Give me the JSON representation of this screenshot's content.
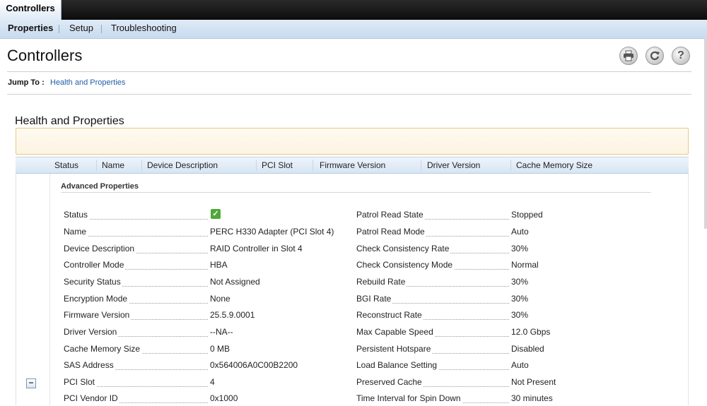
{
  "top_tab": "Controllers",
  "subnav": {
    "items": [
      "Properties",
      "Setup",
      "Troubleshooting"
    ]
  },
  "page_title": "Controllers",
  "toolbar": {
    "print_icon": "printer-icon",
    "refresh_icon": "refresh-icon",
    "help_icon": "help-icon",
    "help_glyph": "?"
  },
  "jump": {
    "label": "Jump To :",
    "link": "Health and Properties"
  },
  "section_title": "Health and Properties",
  "table": {
    "headers": [
      "Status",
      "Name",
      "Device Description",
      "PCI Slot",
      "Firmware Version",
      "Driver Version",
      "Cache Memory Size"
    ]
  },
  "collapse_glyph": "−",
  "advanced": {
    "title": "Advanced Properties",
    "left": [
      {
        "label": "Status",
        "value": "",
        "icon": "status-ok-icon"
      },
      {
        "label": "Name",
        "value": "PERC H330 Adapter (PCI Slot 4)"
      },
      {
        "label": "Device Description",
        "value": "RAID Controller in Slot 4"
      },
      {
        "label": "Controller Mode",
        "value": "HBA"
      },
      {
        "label": "Security Status",
        "value": "Not Assigned"
      },
      {
        "label": "Encryption Mode",
        "value": "None"
      },
      {
        "label": "Firmware Version",
        "value": "25.5.9.0001"
      },
      {
        "label": "Driver Version",
        "value": "--NA--"
      },
      {
        "label": "Cache Memory Size",
        "value": "0 MB"
      },
      {
        "label": "SAS Address",
        "value": "0x564006A0C00B2200"
      },
      {
        "label": "PCI Slot",
        "value": "4"
      },
      {
        "label": "PCI Vendor ID",
        "value": "0x1000"
      }
    ],
    "right": [
      {
        "label": "Patrol Read State",
        "value": "Stopped"
      },
      {
        "label": "Patrol Read Mode",
        "value": "Auto"
      },
      {
        "label": "Check Consistency Rate",
        "value": "30%"
      },
      {
        "label": "Check Consistency Mode",
        "value": "Normal"
      },
      {
        "label": "Rebuild Rate",
        "value": "30%"
      },
      {
        "label": "BGI Rate",
        "value": "30%"
      },
      {
        "label": "Reconstruct Rate",
        "value": "30%"
      },
      {
        "label": "Max Capable Speed",
        "value": "12.0 Gbps"
      },
      {
        "label": "Persistent Hotspare",
        "value": "Disabled"
      },
      {
        "label": "Load Balance Setting",
        "value": "Auto"
      },
      {
        "label": "Preserved Cache",
        "value": "Not Present"
      },
      {
        "label": "Time Interval for Spin Down",
        "value": "30 minutes"
      }
    ]
  },
  "colors": {
    "accent": "#1f5ea8",
    "status_ok": "#4da83a"
  }
}
